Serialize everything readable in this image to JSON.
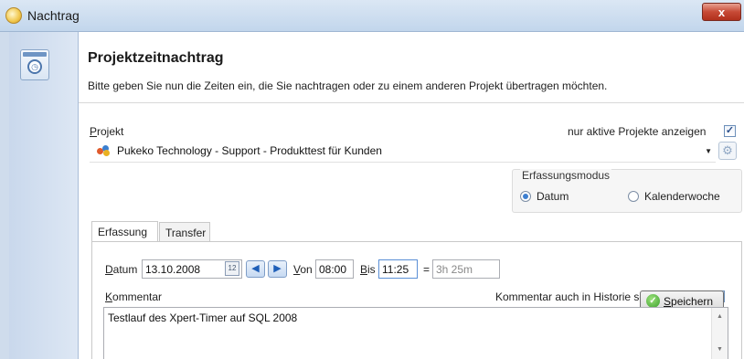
{
  "window": {
    "title": "Nachtrag",
    "close_glyph": "x"
  },
  "header": {
    "title": "Projektzeitnachtrag",
    "subtitle": "Bitte geben Sie nun die Zeiten ein, die Sie nachtragen oder zu einem anderen Projekt übertragen möchten."
  },
  "project": {
    "label_mnemonic": "P",
    "label_rest": "rojekt",
    "only_active_label": "nur aktive Projekte anzeigen",
    "only_active_checked": true,
    "selected": "Pukeko Technology - Support - Produkttest für Kunden"
  },
  "mode": {
    "group_label": "Erfassungsmodus",
    "options": [
      {
        "label": "Datum",
        "selected": true
      },
      {
        "label": "Kalenderwoche",
        "selected": false
      }
    ]
  },
  "tabs": [
    {
      "label": "Erfassung",
      "active": true
    },
    {
      "label": "Transfer",
      "active": false
    }
  ],
  "entry": {
    "date_mnemonic": "D",
    "date_rest": "atum",
    "date_value": "13.10.2008",
    "calendar_glyph": "12",
    "from_mnemonic": "V",
    "from_rest": "on",
    "from_value": "08:00",
    "to_mnemonic": "B",
    "to_rest": "is",
    "to_value": "11:25",
    "equals": "=",
    "duration": "3h 25m",
    "save_mnemonic": "S",
    "save_rest": "peichern"
  },
  "comment": {
    "label_mnemonic": "K",
    "label_rest": "ommentar",
    "history_label": "Kommentar auch in Historie schreiben",
    "history_checked": true,
    "text": "Testlauf des Xpert-Timer auf SQL 2008"
  },
  "glyphs": {
    "check": "✓",
    "dropdown": "▼",
    "prev": "◀",
    "next": "▶",
    "scroll_up": "▲",
    "scroll_down": "▼",
    "clock": "◷",
    "gear": "⚙"
  },
  "colors": {
    "title_bar": "#c2d6ec",
    "sidebar": "#c9d8ec",
    "accent": "#3d7fd0",
    "close_button": "#c74a36"
  }
}
